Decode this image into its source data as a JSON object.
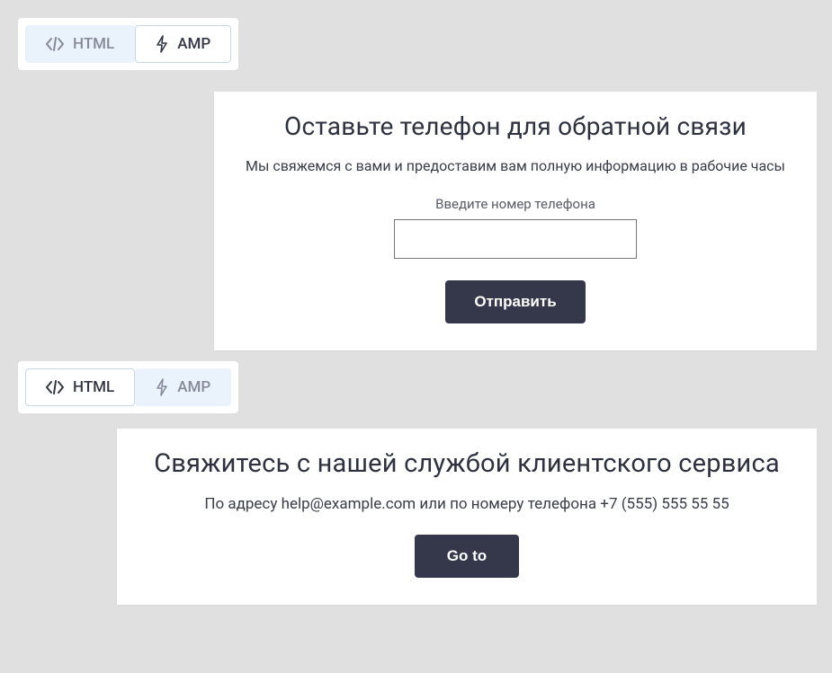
{
  "tabs": {
    "html_label": "HTML",
    "amp_label": "AMP"
  },
  "card1": {
    "title": "Оставьте телефон для обратной связи",
    "subtitle": "Мы свяжемся с вами и предоставим вам полную информацию в рабочие часы",
    "field_label": "Введите номер телефона",
    "button_label": "Отправить"
  },
  "card2": {
    "title": "Свяжитесь с нашей службой клиентского сервиса",
    "subtitle": "По адресу help@example.com или по номеру телефона +7 (555) 555 55 55",
    "button_label": "Go to"
  },
  "colors": {
    "page_bg": "#e0e0e0",
    "tab_inactive_bg": "#eaf3fb",
    "tab_active_border": "#c9d6e4",
    "btn_bg": "#35374a"
  }
}
